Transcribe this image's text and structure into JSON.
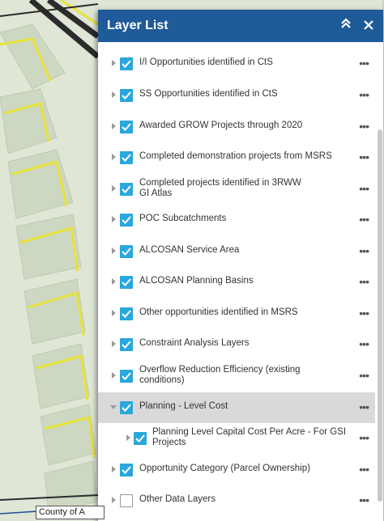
{
  "panel": {
    "title": "Layer List",
    "collapse_icon": "double-chevron-up-icon",
    "close_icon": "close-icon"
  },
  "colors": {
    "header": "#1f5a99",
    "checkbox": "#2aa7dc",
    "selected_row": "#d9d9d9"
  },
  "layers": [
    {
      "label": "I/I Opportunities identified in CtS",
      "checked": true
    },
    {
      "label": "SS Opportunities identified in CtS",
      "checked": true
    },
    {
      "label": "Awarded GROW Projects through 2020",
      "checked": true
    },
    {
      "label": "Completed demonstration projects from MSRS",
      "checked": true
    },
    {
      "label": "Completed projects identified in 3RWW GI Atlas",
      "checked": true
    },
    {
      "label": "POC Subcatchments",
      "checked": true
    },
    {
      "label": "ALCOSAN Service Area",
      "checked": true
    },
    {
      "label": "ALCOSAN Planning Basins",
      "checked": true
    },
    {
      "label": "Other opportunities identified in MSRS",
      "checked": true
    },
    {
      "label": "Constraint Analysis Layers",
      "checked": true
    },
    {
      "label": "Overflow Reduction Efficiency (existing conditions)",
      "checked": true
    },
    {
      "label": "Planning - Level Cost",
      "checked": true,
      "expanded": true,
      "selected": true
    },
    {
      "label": "Planning Level Capital Cost Per Acre - For GSI Projects",
      "checked": true,
      "sublayer": true
    },
    {
      "label": "Opportunity Category (Parcel Ownership)",
      "checked": true
    },
    {
      "label": "Other Data Layers",
      "checked": false
    }
  ],
  "map": {
    "attribution_text": "County of A"
  }
}
